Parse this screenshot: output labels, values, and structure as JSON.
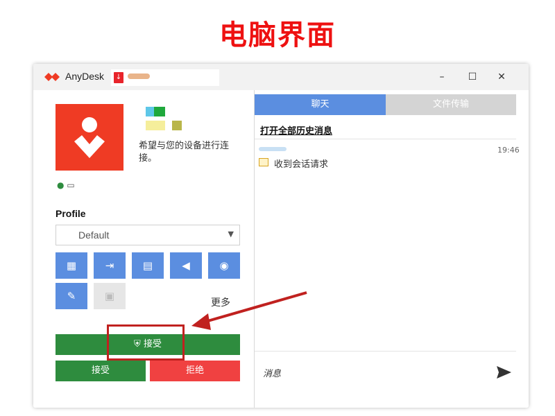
{
  "page": {
    "heading": "电脑界面"
  },
  "window": {
    "app_name": "AnyDesk",
    "controls": {
      "minimize": "–",
      "maximize": "☐",
      "close": "✕"
    }
  },
  "left": {
    "status_text": "希望与您的设备进行连接。",
    "profile_label": "Profile",
    "profile_value": "Default",
    "toolbar": [
      {
        "icon": "keyboard-mouse-icon"
      },
      {
        "icon": "switch-side-icon"
      },
      {
        "icon": "clipboard-icon"
      },
      {
        "icon": "audio-icon"
      },
      {
        "icon": "screen-record-icon"
      },
      {
        "icon": "draw-pen-icon"
      },
      {
        "icon": "block-screen-icon"
      }
    ],
    "more_label": "更多",
    "accept_wide_label": "接受",
    "accept_label": "接受",
    "reject_label": "拒绝"
  },
  "right": {
    "tabs": [
      {
        "label": "聊天"
      },
      {
        "label": "文件传输"
      }
    ],
    "history_link": "打开全部历史消息",
    "messages": [
      {
        "time": "19:46",
        "text": "收到会话请求"
      }
    ],
    "input_placeholder": "消息"
  },
  "colors": {
    "accent_blue": "#5b8ee0",
    "accept_green": "#2e8c3e",
    "reject_red": "#f04141",
    "brand_red": "#ef3b24",
    "highlight_red": "#c0211f"
  }
}
